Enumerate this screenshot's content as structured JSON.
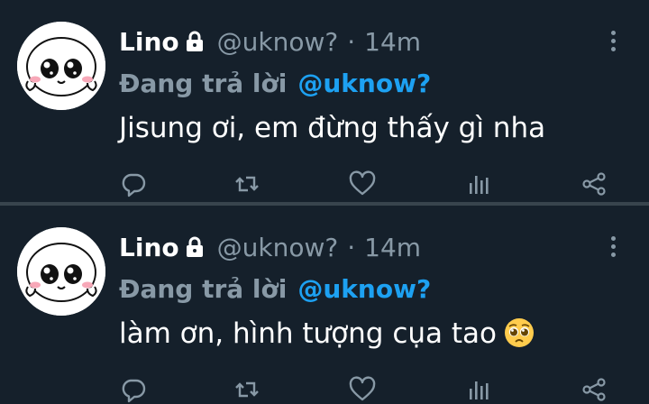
{
  "tweets": [
    {
      "display_name": "Lino",
      "handle": "@uknow?",
      "separator": "·",
      "time": "14m",
      "reply_prefix": "Đang trả lời",
      "reply_handle": "@uknow?",
      "text": "Jisung ơi, em đừng thấy gì nha",
      "has_emoji": false
    },
    {
      "display_name": "Lino",
      "handle": "@uknow?",
      "separator": "·",
      "time": "14m",
      "reply_prefix": "Đang trả lời",
      "reply_handle": "@uknow?",
      "text": "làm ơn, hình tượng cụa tao",
      "has_emoji": true,
      "emoji": "pleading-face"
    }
  ],
  "colors": {
    "background": "#15202b",
    "divider": "#38444d",
    "secondary_text": "#8899a6",
    "accent": "#1da1f2",
    "primary_text": "#ffffff"
  },
  "icons": {
    "lock": "lock-icon",
    "more": "more-vertical-icon",
    "reply": "reply-icon",
    "retweet": "retweet-icon",
    "like": "heart-icon",
    "stats": "analytics-icon",
    "share": "share-icon"
  }
}
